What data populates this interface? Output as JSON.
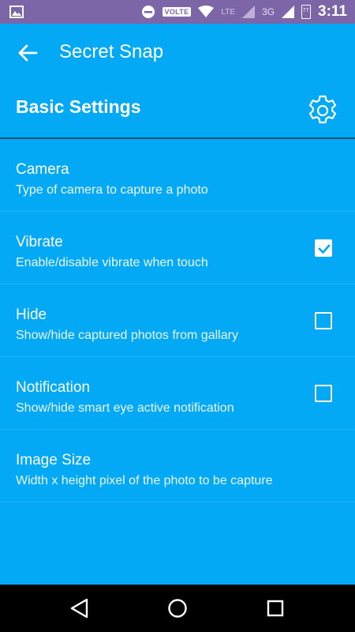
{
  "status_bar": {
    "time": "3:11",
    "volte": "VOLTE",
    "lte": "LTE",
    "network": "3G",
    "battery_level": "77"
  },
  "toolbar": {
    "title": "Secret Snap"
  },
  "section": {
    "title": "Basic Settings"
  },
  "settings": [
    {
      "title": "Camera",
      "subtitle": "Type of camera to capture a photo",
      "has_checkbox": false
    },
    {
      "title": "Vibrate",
      "subtitle": "Enable/disable vibrate when touch",
      "has_checkbox": true,
      "checked": true
    },
    {
      "title": "Hide",
      "subtitle": "Show/hide captured photos from gallary",
      "has_checkbox": true,
      "checked": false
    },
    {
      "title": "Notification",
      "subtitle": "Show/hide smart eye active notification",
      "has_checkbox": true,
      "checked": false
    },
    {
      "title": "Image Size",
      "subtitle": "Width x height pixel of the photo to be capture",
      "has_checkbox": false
    }
  ],
  "colors": {
    "background": "#03A9F4",
    "status_bar": "#7C66A8",
    "nav_bar": "#000000"
  }
}
